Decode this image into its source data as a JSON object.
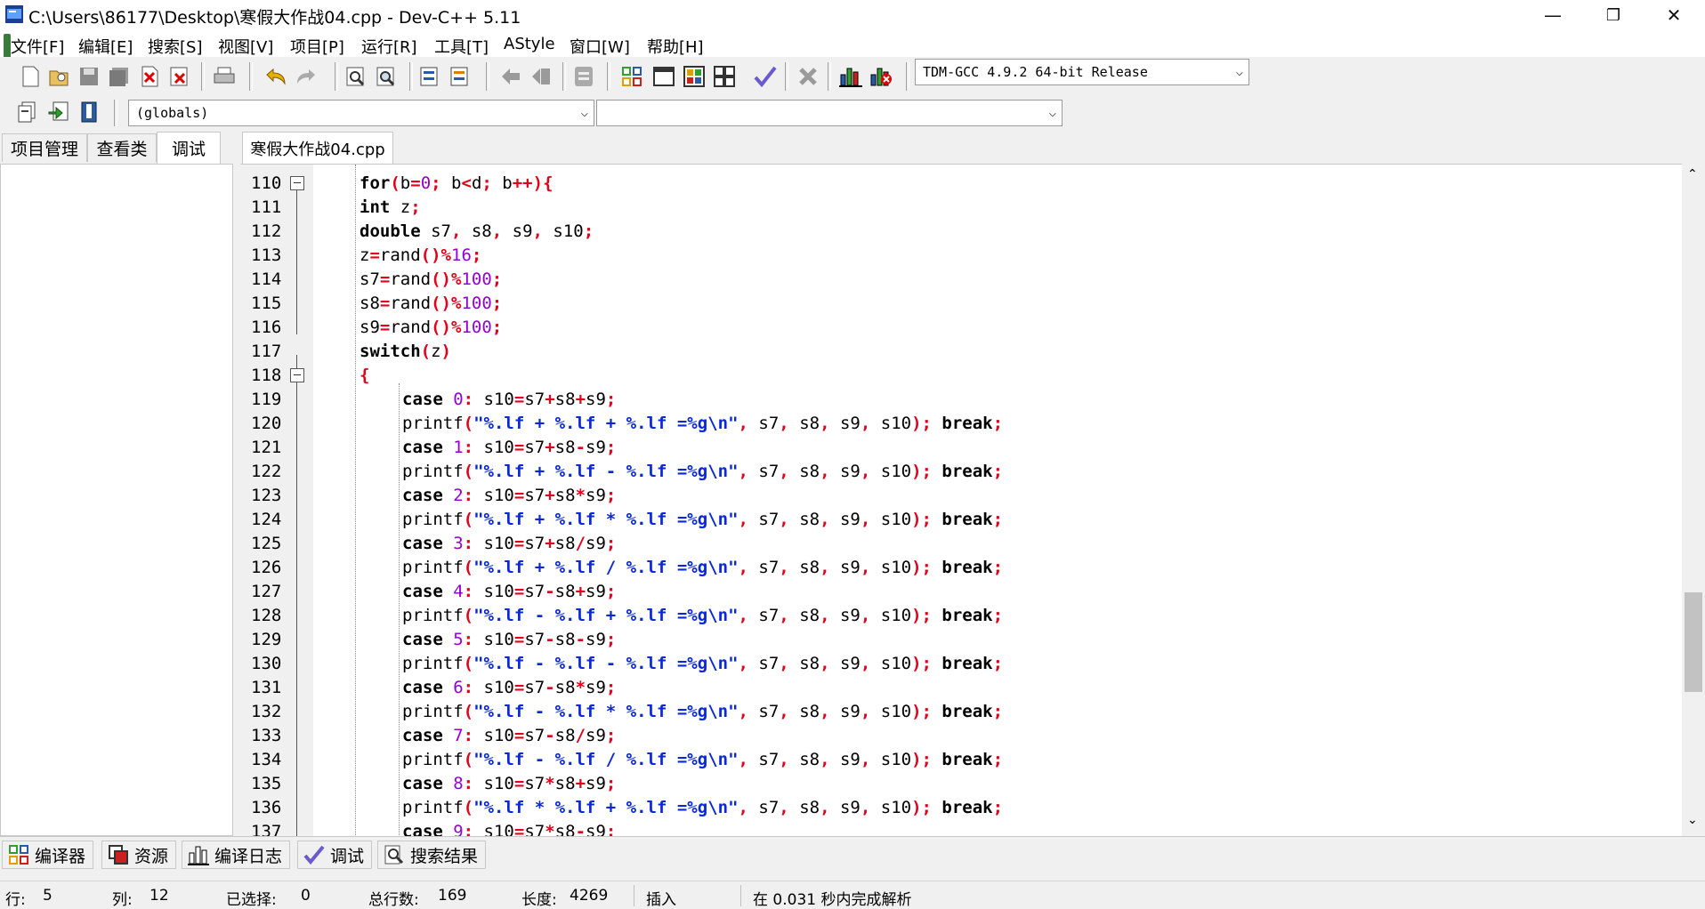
{
  "window": {
    "title": "C:\\Users\\86177\\Desktop\\寒假大作战04.cpp - Dev-C++ 5.11",
    "minimize": "—",
    "restore": "❐",
    "close": "✕"
  },
  "menu": [
    "文件[F]",
    "编辑[E]",
    "搜索[S]",
    "视图[V]",
    "项目[P]",
    "运行[R]",
    "工具[T]",
    "AStyle",
    "窗口[W]",
    "帮助[H]"
  ],
  "toolbar": {
    "compiler": "TDM-GCC 4.9.2 64-bit Release",
    "scope": "(globals)",
    "function": ""
  },
  "left_tabs": [
    "项目管理",
    "查看类",
    "调试"
  ],
  "editor_tab": "寒假大作战04.cpp",
  "code_lines": [
    {
      "n": "110",
      "fold": true,
      "indent": 0,
      "tokens": [
        [
          "kw",
          "for"
        ],
        [
          "sym",
          "("
        ],
        [
          "id",
          "b"
        ],
        [
          "sym",
          "="
        ],
        [
          "num",
          "0"
        ],
        [
          "sym",
          ";"
        ],
        [
          "id",
          " b"
        ],
        [
          "sym",
          "<"
        ],
        [
          "id",
          "d"
        ],
        [
          "sym",
          ";"
        ],
        [
          "id",
          " b"
        ],
        [
          "sym",
          "++"
        ],
        [
          "sym",
          "){"
        ]
      ]
    },
    {
      "n": "111",
      "indent": 0,
      "tokens": [
        [
          "kw",
          "int"
        ],
        [
          "id",
          " z"
        ],
        [
          "sym",
          ";"
        ]
      ]
    },
    {
      "n": "112",
      "indent": 0,
      "tokens": [
        [
          "kw",
          "double"
        ],
        [
          "id",
          " s7"
        ],
        [
          "sym",
          ","
        ],
        [
          "id",
          " s8"
        ],
        [
          "sym",
          ","
        ],
        [
          "id",
          " s9"
        ],
        [
          "sym",
          ","
        ],
        [
          "id",
          " s10"
        ],
        [
          "sym",
          ";"
        ]
      ]
    },
    {
      "n": "113",
      "indent": 0,
      "tokens": [
        [
          "id",
          "z"
        ],
        [
          "sym",
          "="
        ],
        [
          "id",
          "rand"
        ],
        [
          "sym",
          "()%"
        ],
        [
          "num",
          "16"
        ],
        [
          "sym",
          ";"
        ]
      ]
    },
    {
      "n": "114",
      "indent": 0,
      "tokens": [
        [
          "id",
          "s7"
        ],
        [
          "sym",
          "="
        ],
        [
          "id",
          "rand"
        ],
        [
          "sym",
          "()%"
        ],
        [
          "num",
          "100"
        ],
        [
          "sym",
          ";"
        ]
      ]
    },
    {
      "n": "115",
      "indent": 0,
      "tokens": [
        [
          "id",
          "s8"
        ],
        [
          "sym",
          "="
        ],
        [
          "id",
          "rand"
        ],
        [
          "sym",
          "()%"
        ],
        [
          "num",
          "100"
        ],
        [
          "sym",
          ";"
        ]
      ]
    },
    {
      "n": "116",
      "indent": 0,
      "tokens": [
        [
          "id",
          "s9"
        ],
        [
          "sym",
          "="
        ],
        [
          "id",
          "rand"
        ],
        [
          "sym",
          "()%"
        ],
        [
          "num",
          "100"
        ],
        [
          "sym",
          ";"
        ]
      ]
    },
    {
      "n": "117",
      "indent": 0,
      "tokens": [
        [
          "kw",
          "switch"
        ],
        [
          "sym",
          "("
        ],
        [
          "id",
          "z"
        ],
        [
          "sym",
          ")"
        ]
      ]
    },
    {
      "n": "118",
      "fold": true,
      "indent": 0,
      "tokens": [
        [
          "sym",
          "{"
        ]
      ]
    },
    {
      "n": "119",
      "indent": 1,
      "tokens": [
        [
          "kw",
          "case"
        ],
        [
          "num",
          " 0"
        ],
        [
          "sym",
          ":"
        ],
        [
          "id",
          " s10"
        ],
        [
          "sym",
          "="
        ],
        [
          "id",
          "s7"
        ],
        [
          "sym",
          "+"
        ],
        [
          "id",
          "s8"
        ],
        [
          "sym",
          "+"
        ],
        [
          "id",
          "s9"
        ],
        [
          "sym",
          ";"
        ]
      ]
    },
    {
      "n": "120",
      "indent": 1,
      "tokens": [
        [
          "id",
          "printf"
        ],
        [
          "sym",
          "("
        ],
        [
          "str",
          "\"%.lf + %.lf + %.lf =%g\\n\""
        ],
        [
          "sym",
          ","
        ],
        [
          "id",
          " s7"
        ],
        [
          "sym",
          ","
        ],
        [
          "id",
          " s8"
        ],
        [
          "sym",
          ","
        ],
        [
          "id",
          " s9"
        ],
        [
          "sym",
          ","
        ],
        [
          "id",
          " s10"
        ],
        [
          "sym",
          ");"
        ],
        [
          "kw",
          " break"
        ],
        [
          "sym",
          ";"
        ]
      ]
    },
    {
      "n": "121",
      "indent": 1,
      "tokens": [
        [
          "kw",
          "case"
        ],
        [
          "num",
          " 1"
        ],
        [
          "sym",
          ":"
        ],
        [
          "id",
          " s10"
        ],
        [
          "sym",
          "="
        ],
        [
          "id",
          "s7"
        ],
        [
          "sym",
          "+"
        ],
        [
          "id",
          "s8"
        ],
        [
          "sym",
          "-"
        ],
        [
          "id",
          "s9"
        ],
        [
          "sym",
          ";"
        ]
      ]
    },
    {
      "n": "122",
      "indent": 1,
      "tokens": [
        [
          "id",
          "printf"
        ],
        [
          "sym",
          "("
        ],
        [
          "str",
          "\"%.lf + %.lf - %.lf =%g\\n\""
        ],
        [
          "sym",
          ","
        ],
        [
          "id",
          " s7"
        ],
        [
          "sym",
          ","
        ],
        [
          "id",
          " s8"
        ],
        [
          "sym",
          ","
        ],
        [
          "id",
          " s9"
        ],
        [
          "sym",
          ","
        ],
        [
          "id",
          " s10"
        ],
        [
          "sym",
          ");"
        ],
        [
          "kw",
          " break"
        ],
        [
          "sym",
          ";"
        ]
      ]
    },
    {
      "n": "123",
      "indent": 1,
      "tokens": [
        [
          "kw",
          "case"
        ],
        [
          "num",
          " 2"
        ],
        [
          "sym",
          ":"
        ],
        [
          "id",
          " s10"
        ],
        [
          "sym",
          "="
        ],
        [
          "id",
          "s7"
        ],
        [
          "sym",
          "+"
        ],
        [
          "id",
          "s8"
        ],
        [
          "sym",
          "*"
        ],
        [
          "id",
          "s9"
        ],
        [
          "sym",
          ";"
        ]
      ]
    },
    {
      "n": "124",
      "indent": 1,
      "tokens": [
        [
          "id",
          "printf"
        ],
        [
          "sym",
          "("
        ],
        [
          "str",
          "\"%.lf + %.lf * %.lf =%g\\n\""
        ],
        [
          "sym",
          ","
        ],
        [
          "id",
          " s7"
        ],
        [
          "sym",
          ","
        ],
        [
          "id",
          " s8"
        ],
        [
          "sym",
          ","
        ],
        [
          "id",
          " s9"
        ],
        [
          "sym",
          ","
        ],
        [
          "id",
          " s10"
        ],
        [
          "sym",
          ");"
        ],
        [
          "kw",
          " break"
        ],
        [
          "sym",
          ";"
        ]
      ]
    },
    {
      "n": "125",
      "indent": 1,
      "tokens": [
        [
          "kw",
          "case"
        ],
        [
          "num",
          " 3"
        ],
        [
          "sym",
          ":"
        ],
        [
          "id",
          " s10"
        ],
        [
          "sym",
          "="
        ],
        [
          "id",
          "s7"
        ],
        [
          "sym",
          "+"
        ],
        [
          "id",
          "s8"
        ],
        [
          "sym",
          "/"
        ],
        [
          "id",
          "s9"
        ],
        [
          "sym",
          ";"
        ]
      ]
    },
    {
      "n": "126",
      "indent": 1,
      "tokens": [
        [
          "id",
          "printf"
        ],
        [
          "sym",
          "("
        ],
        [
          "str",
          "\"%.lf + %.lf / %.lf =%g\\n\""
        ],
        [
          "sym",
          ","
        ],
        [
          "id",
          " s7"
        ],
        [
          "sym",
          ","
        ],
        [
          "id",
          " s8"
        ],
        [
          "sym",
          ","
        ],
        [
          "id",
          " s9"
        ],
        [
          "sym",
          ","
        ],
        [
          "id",
          " s10"
        ],
        [
          "sym",
          ");"
        ],
        [
          "kw",
          " break"
        ],
        [
          "sym",
          ";"
        ]
      ]
    },
    {
      "n": "127",
      "indent": 1,
      "tokens": [
        [
          "kw",
          "case"
        ],
        [
          "num",
          " 4"
        ],
        [
          "sym",
          ":"
        ],
        [
          "id",
          " s10"
        ],
        [
          "sym",
          "="
        ],
        [
          "id",
          "s7"
        ],
        [
          "sym",
          "-"
        ],
        [
          "id",
          "s8"
        ],
        [
          "sym",
          "+"
        ],
        [
          "id",
          "s9"
        ],
        [
          "sym",
          ";"
        ]
      ]
    },
    {
      "n": "128",
      "indent": 1,
      "tokens": [
        [
          "id",
          "printf"
        ],
        [
          "sym",
          "("
        ],
        [
          "str",
          "\"%.lf - %.lf + %.lf =%g\\n\""
        ],
        [
          "sym",
          ","
        ],
        [
          "id",
          " s7"
        ],
        [
          "sym",
          ","
        ],
        [
          "id",
          " s8"
        ],
        [
          "sym",
          ","
        ],
        [
          "id",
          " s9"
        ],
        [
          "sym",
          ","
        ],
        [
          "id",
          " s10"
        ],
        [
          "sym",
          ");"
        ],
        [
          "kw",
          " break"
        ],
        [
          "sym",
          ";"
        ]
      ]
    },
    {
      "n": "129",
      "indent": 1,
      "tokens": [
        [
          "kw",
          "case"
        ],
        [
          "num",
          " 5"
        ],
        [
          "sym",
          ":"
        ],
        [
          "id",
          " s10"
        ],
        [
          "sym",
          "="
        ],
        [
          "id",
          "s7"
        ],
        [
          "sym",
          "-"
        ],
        [
          "id",
          "s8"
        ],
        [
          "sym",
          "-"
        ],
        [
          "id",
          "s9"
        ],
        [
          "sym",
          ";"
        ]
      ]
    },
    {
      "n": "130",
      "indent": 1,
      "tokens": [
        [
          "id",
          "printf"
        ],
        [
          "sym",
          "("
        ],
        [
          "str",
          "\"%.lf - %.lf - %.lf =%g\\n\""
        ],
        [
          "sym",
          ","
        ],
        [
          "id",
          " s7"
        ],
        [
          "sym",
          ","
        ],
        [
          "id",
          " s8"
        ],
        [
          "sym",
          ","
        ],
        [
          "id",
          " s9"
        ],
        [
          "sym",
          ","
        ],
        [
          "id",
          " s10"
        ],
        [
          "sym",
          ");"
        ],
        [
          "kw",
          " break"
        ],
        [
          "sym",
          ";"
        ]
      ]
    },
    {
      "n": "131",
      "indent": 1,
      "tokens": [
        [
          "kw",
          "case"
        ],
        [
          "num",
          " 6"
        ],
        [
          "sym",
          ":"
        ],
        [
          "id",
          " s10"
        ],
        [
          "sym",
          "="
        ],
        [
          "id",
          "s7"
        ],
        [
          "sym",
          "-"
        ],
        [
          "id",
          "s8"
        ],
        [
          "sym",
          "*"
        ],
        [
          "id",
          "s9"
        ],
        [
          "sym",
          ";"
        ]
      ]
    },
    {
      "n": "132",
      "indent": 1,
      "tokens": [
        [
          "id",
          "printf"
        ],
        [
          "sym",
          "("
        ],
        [
          "str",
          "\"%.lf - %.lf * %.lf =%g\\n\""
        ],
        [
          "sym",
          ","
        ],
        [
          "id",
          " s7"
        ],
        [
          "sym",
          ","
        ],
        [
          "id",
          " s8"
        ],
        [
          "sym",
          ","
        ],
        [
          "id",
          " s9"
        ],
        [
          "sym",
          ","
        ],
        [
          "id",
          " s10"
        ],
        [
          "sym",
          ");"
        ],
        [
          "kw",
          " break"
        ],
        [
          "sym",
          ";"
        ]
      ]
    },
    {
      "n": "133",
      "indent": 1,
      "tokens": [
        [
          "kw",
          "case"
        ],
        [
          "num",
          " 7"
        ],
        [
          "sym",
          ":"
        ],
        [
          "id",
          " s10"
        ],
        [
          "sym",
          "="
        ],
        [
          "id",
          "s7"
        ],
        [
          "sym",
          "-"
        ],
        [
          "id",
          "s8"
        ],
        [
          "sym",
          "/"
        ],
        [
          "id",
          "s9"
        ],
        [
          "sym",
          ";"
        ]
      ]
    },
    {
      "n": "134",
      "indent": 1,
      "tokens": [
        [
          "id",
          "printf"
        ],
        [
          "sym",
          "("
        ],
        [
          "str",
          "\"%.lf - %.lf / %.lf =%g\\n\""
        ],
        [
          "sym",
          ","
        ],
        [
          "id",
          " s7"
        ],
        [
          "sym",
          ","
        ],
        [
          "id",
          " s8"
        ],
        [
          "sym",
          ","
        ],
        [
          "id",
          " s9"
        ],
        [
          "sym",
          ","
        ],
        [
          "id",
          " s10"
        ],
        [
          "sym",
          ");"
        ],
        [
          "kw",
          " break"
        ],
        [
          "sym",
          ";"
        ]
      ]
    },
    {
      "n": "135",
      "indent": 1,
      "tokens": [
        [
          "kw",
          "case"
        ],
        [
          "num",
          " 8"
        ],
        [
          "sym",
          ":"
        ],
        [
          "id",
          " s10"
        ],
        [
          "sym",
          "="
        ],
        [
          "id",
          "s7"
        ],
        [
          "sym",
          "*"
        ],
        [
          "id",
          "s8"
        ],
        [
          "sym",
          "+"
        ],
        [
          "id",
          "s9"
        ],
        [
          "sym",
          ";"
        ]
      ]
    },
    {
      "n": "136",
      "indent": 1,
      "tokens": [
        [
          "id",
          "printf"
        ],
        [
          "sym",
          "("
        ],
        [
          "str",
          "\"%.lf * %.lf + %.lf =%g\\n\""
        ],
        [
          "sym",
          ","
        ],
        [
          "id",
          " s7"
        ],
        [
          "sym",
          ","
        ],
        [
          "id",
          " s8"
        ],
        [
          "sym",
          ","
        ],
        [
          "id",
          " s9"
        ],
        [
          "sym",
          ","
        ],
        [
          "id",
          " s10"
        ],
        [
          "sym",
          ");"
        ],
        [
          "kw",
          " break"
        ],
        [
          "sym",
          ";"
        ]
      ]
    },
    {
      "n": "137",
      "indent": 1,
      "tokens": [
        [
          "kw",
          "case"
        ],
        [
          "num",
          " 9"
        ],
        [
          "sym",
          ":"
        ],
        [
          "id",
          " s10"
        ],
        [
          "sym",
          "="
        ],
        [
          "id",
          "s7"
        ],
        [
          "sym",
          "*"
        ],
        [
          "id",
          "s8"
        ],
        [
          "sym",
          "-"
        ],
        [
          "id",
          "s9"
        ],
        [
          "sym",
          ";"
        ]
      ]
    }
  ],
  "bottom_tabs": [
    {
      "label": "编译器",
      "icon": "grid-icon"
    },
    {
      "label": "资源",
      "icon": "resources-icon"
    },
    {
      "label": "编译日志",
      "icon": "bar-chart-icon"
    },
    {
      "label": "调试",
      "icon": "check-icon"
    },
    {
      "label": "搜索结果",
      "icon": "search-icon"
    }
  ],
  "status": {
    "row_label": "行:",
    "row_value": "5",
    "col_label": "列:",
    "col_value": "12",
    "sel_label": "已选择:",
    "sel_value": "0",
    "lines_label": "总行数:",
    "lines_value": "169",
    "len_label": "长度:",
    "len_value": "4269",
    "mode": "插入",
    "parse": "在 0.031 秒内完成解析"
  },
  "colors": {
    "keyword": "#000000",
    "symbol": "#e0001b",
    "number": "#9400d3",
    "string": "#0a28d6"
  }
}
